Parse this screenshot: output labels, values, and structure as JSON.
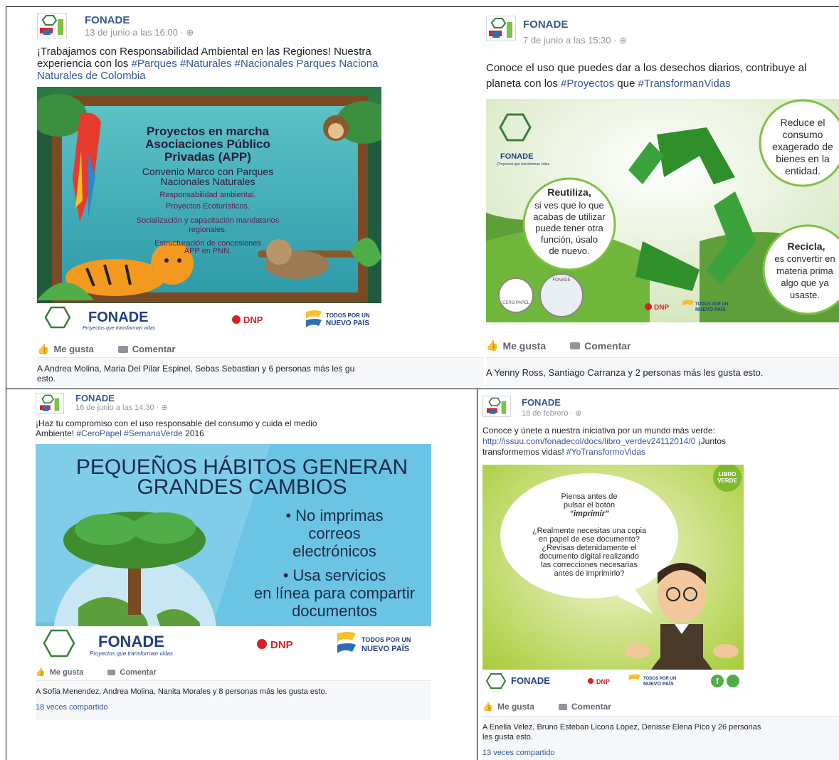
{
  "posts": [
    {
      "page_name": "FONADE",
      "date": "13 de junio a las 16:00 · ",
      "text_lines": [
        "¡Trabajamos con Responsabilidad Ambiental en las Regiones! Nuestra",
        "experiencia con los ",
        "#Parques #Naturales #Nacionales Parques Naciona",
        "Naturales de Colombia"
      ],
      "image": {
        "title_lines": [
          "Proyectos en marcha",
          "Asociaciones Público",
          "Privadas (APP)"
        ],
        "subtitle_lines": [
          "Convenio Marco con Parques",
          "Nacionales Naturales"
        ],
        "items": [
          "Responsabilidad ambiental.",
          "Proyectos Ecoturísticos.",
          "Socialización y capacitación mandatarios",
          "regionales.",
          "Estructuración de concesiones",
          "APP en PNN."
        ],
        "logo": "FONADE",
        "logo_tagline": "Proyectos que transforman vidas",
        "dnp": "DNP",
        "todos_lines": [
          "TODOS POR UN",
          "NUEVO PAÍS"
        ]
      },
      "like_label": "Me gusta",
      "comment_label": "Comentar",
      "likes_text": "A Andrea Molina, Maria Del Pilar Espinel, Sebas Sebastian y 6 personas más les gu",
      "likes_text2": "esto."
    },
    {
      "page_name": "FONADE",
      "date": "7 de junio a las 15:30 · ",
      "text_lines": [
        "Conoce el uso que puedes dar a los desechos diarios, contribuye al",
        "planeta con los ",
        "#Proyectos",
        " que ",
        "#TransformanVidas"
      ],
      "image": {
        "logo": "FONADE",
        "logo_tagline": "Proyectos que transforman vidas",
        "reduce_lines": [
          "Reduce el",
          "consumo",
          "exagerado de",
          "bienes en la",
          "entidad."
        ],
        "reutiliza_title": "Reutiliza,",
        "reutiliza_lines": [
          "si ves que lo que",
          "acabas de utilizar",
          "puede tener otra",
          "función, úsalo",
          "de nuevo."
        ],
        "recicla_title": "Recicla,",
        "recicla_lines": [
          "es convertir en",
          "materia prima",
          "algo que ya",
          "usaste."
        ],
        "badge1": "CERO PAPEL",
        "badge2": "FONADE",
        "dnp": "DNP",
        "todos_lines": [
          "TODOS POR UN",
          "NUEVO PAÍS"
        ]
      },
      "like_label": "Me gusta",
      "comment_label": "Comentar",
      "likes_text": "A Yenny Ross, Santiago Carranza y 2 personas más les gusta esto."
    },
    {
      "page_name": "FONADE",
      "date": "16 de junio a las 14:30 · ",
      "text_lines": [
        "¡Haz tu compromiso con el uso responsable del consumo y cuida el medio",
        "Ambiente! ",
        "#CeroPapel #SemanaVerde",
        " 2016"
      ],
      "image": {
        "headline_lines": [
          "PEQUEÑOS HÁBITOS GENERAN",
          "GRANDES CAMBIOS"
        ],
        "bullet1_lines": [
          "• No imprimas",
          "correos",
          "electrónicos"
        ],
        "bullet2_lines": [
          "• Usa servicios",
          "en línea para compartir",
          "documentos"
        ],
        "logo": "FONADE",
        "logo_tagline": "Proyectos que transforman vidas",
        "dnp": "DNP",
        "todos_lines": [
          "TODOS POR UN",
          "NUEVO PAÍS"
        ]
      },
      "like_label": "Me gusta",
      "comment_label": "Comentar",
      "likes_text": "A Sofia Menendez, Andrea Molina, Nanita Morales y 8 personas más les gusta esto.",
      "shares": "18 veces compartido"
    },
    {
      "page_name": "FONADE",
      "date": "18 de febrero · ",
      "text_lines": [
        "Conoce y únete a nuestra iniciativa por un mundo más verde:",
        "http://issuu.com/fonadecol/docs/libro_verdev24112014/0",
        " ¡Juntos",
        "transformemos vidas! ",
        "#YoTransformoVidas"
      ],
      "image": {
        "badge_lines": [
          "LIBRO",
          "VERDE"
        ],
        "bubble_lines": [
          "Piensa antes de",
          "pulsar el botón",
          "“imprimir”",
          "",
          "¿Realmente necesitas una copia",
          "en papel de ese documento?",
          "¿Revisas detenidamente el",
          "documento digital realizando",
          "las correcciones necesarias",
          "antes de imprimirlo?"
        ],
        "logo": "FONADE",
        "dnp": "DNP",
        "todos_lines": [
          "TODOS POR UN",
          "NUEVO PAÍS"
        ]
      },
      "like_label": "Me gusta",
      "comment_label": "Comentar",
      "likes_text": "A Enelia Velez, Bruno Esteban Licona Lopez, Denisse Elena Pico y 26 personas",
      "likes_text2": "les gusta esto.",
      "shares": "13 veces compartido"
    }
  ],
  "colors": {
    "link": "#365899",
    "meta": "#90949c",
    "border": "#000000"
  }
}
